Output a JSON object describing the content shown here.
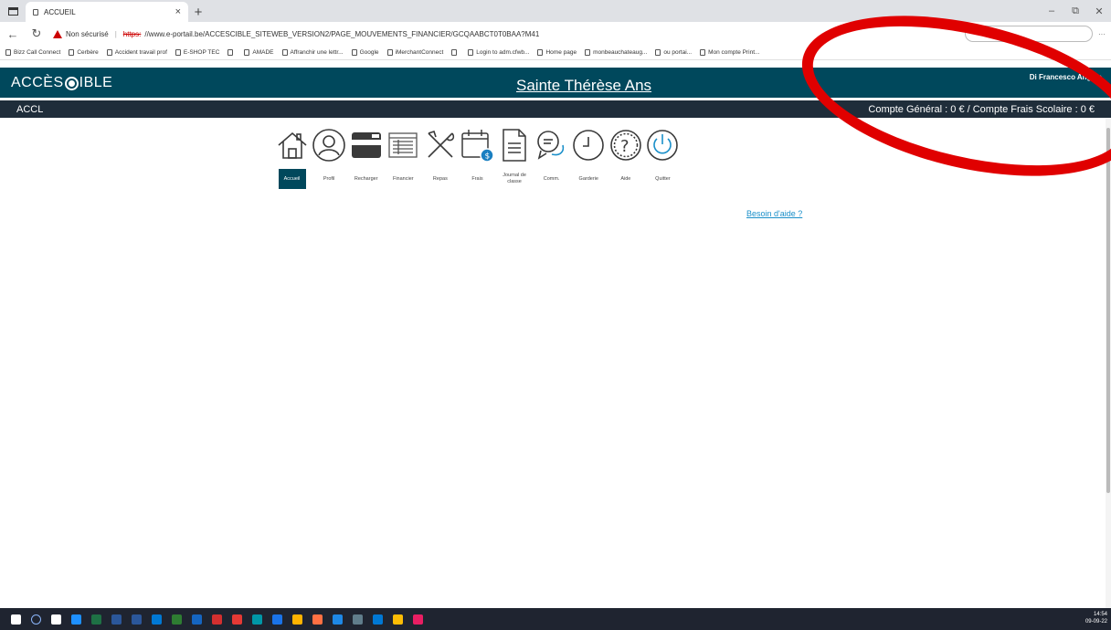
{
  "browser": {
    "tab_title": "ACCUEIL",
    "tab_close": "×",
    "new_tab": "+",
    "minimize": "–",
    "restore": "⧉",
    "close": "✕",
    "security_label": "Non sécurisé",
    "url_protocol": "https:",
    "url_rest": "//www.e-portail.be/ACCESCIBLE_SITEWEB_VERSION2/PAGE_MOUVEMENTS_FINANCIER/GCQAABCT0T0BAA?M41",
    "more": "···"
  },
  "bookmarks": [
    {
      "label": "Bizz Call Connect"
    },
    {
      "label": "Cerbère"
    },
    {
      "label": "Accident travail prof"
    },
    {
      "label": "E-SHOP TEC"
    },
    {
      "label": ""
    },
    {
      "label": "AMADE"
    },
    {
      "label": "Affranchir une lettr..."
    },
    {
      "label": "Google"
    },
    {
      "label": "iMerchantConnect"
    },
    {
      "label": ""
    },
    {
      "label": "Login to adm.cfwb..."
    },
    {
      "label": "Home page"
    },
    {
      "label": "monbeauchateaug..."
    },
    {
      "label": "ou portai..."
    },
    {
      "label": "Mon compte Print..."
    }
  ],
  "header": {
    "logo_left": "ACCÈS",
    "logo_right": "IBLE",
    "school": "Sainte Thérèse Ans",
    "user": "Di Francesco Angelo"
  },
  "account_bar": {
    "label": "ACCL",
    "balance": "Compte Général : 0 € / Compte Frais Scolaire : 0 €"
  },
  "menu": [
    {
      "label": "Accueil",
      "icon": "home-icon",
      "active": true
    },
    {
      "label": "Profil",
      "icon": "profile-icon"
    },
    {
      "label": "Recharger",
      "icon": "card-icon"
    },
    {
      "label": "Financier",
      "icon": "spreadsheet-icon"
    },
    {
      "label": "Repas",
      "icon": "cutlery-icon"
    },
    {
      "label": "Frais",
      "icon": "calendar-money-icon"
    },
    {
      "label": "Journal de classe",
      "icon": "document-icon"
    },
    {
      "label": "Comm.",
      "icon": "chat-icon"
    },
    {
      "label": "Garderie",
      "icon": "clock-icon"
    },
    {
      "label": "Aide",
      "icon": "help-icon"
    },
    {
      "label": "Quitter",
      "icon": "power-icon"
    }
  ],
  "help_link": "Besoin d'aide ?",
  "taskbar": {
    "time": "14:54",
    "date": "09-09-22",
    "colors": [
      "#ffffff",
      "#8ab4f8",
      "#ffffff",
      "#1e90ff",
      "#1e7145",
      "#2b579a",
      "#2b579a",
      "#0078d4",
      "#2e7d32",
      "#1565c0",
      "#d32f2f",
      "#e53935",
      "#0097a7",
      "#1a73e8",
      "#ffb300",
      "#ff7043",
      "#1e88e5",
      "#607d8b",
      "#0078d4",
      "#fbbc05",
      "#e91e63"
    ]
  },
  "annotation_color": "#e00000",
  "accent_color": "#00485c"
}
